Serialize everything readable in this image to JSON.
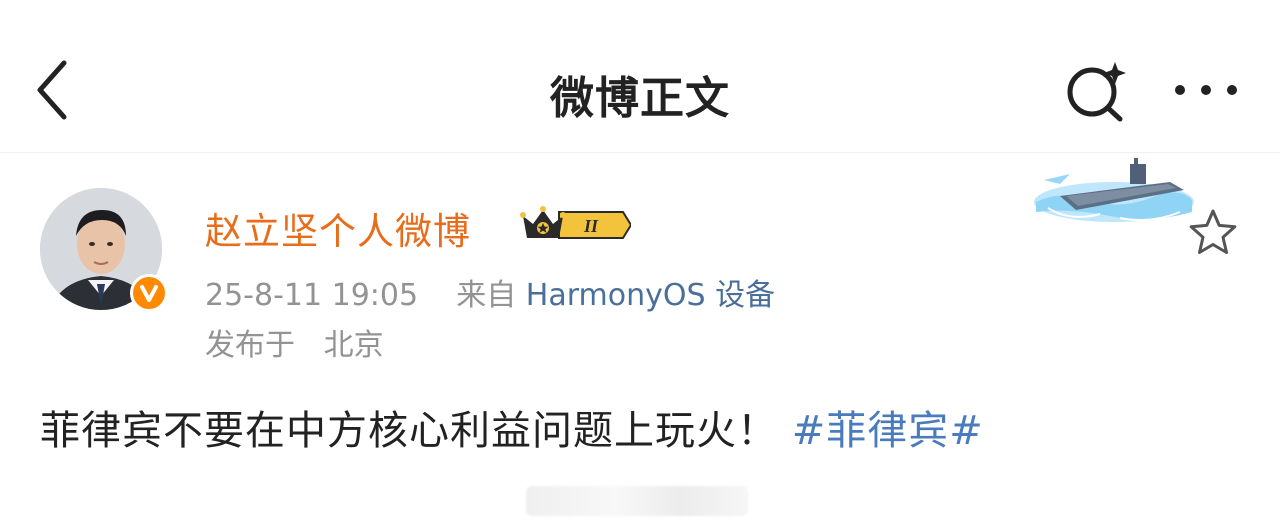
{
  "nav": {
    "title": "微博正文",
    "icons": {
      "back": "chevron-left-icon",
      "search": "search-sparkle-icon",
      "more": "more-dots-icon"
    }
  },
  "author": {
    "name": "赵立坚个人微博",
    "verified_icon": "verified-v-icon",
    "vip_badge": {
      "icon": "crown-icon",
      "level": "II"
    }
  },
  "meta": {
    "time": "25-8-11 19:05",
    "from_prefix": "来自",
    "source": "HarmonyOS 设备",
    "location_prefix": "发布于",
    "location": "北京"
  },
  "post": {
    "text": "菲律宾不要在中方核心利益问题上玩火！",
    "hashtag": "#菲律宾#"
  },
  "actions": {
    "favorite_icon": "star-outline-icon"
  },
  "colors": {
    "username": "#e86c1a",
    "source_link": "#4a6f9a",
    "hashtag": "#4a7bbd",
    "meta_gray": "#939393",
    "verify_orange": "#ff8a00"
  }
}
